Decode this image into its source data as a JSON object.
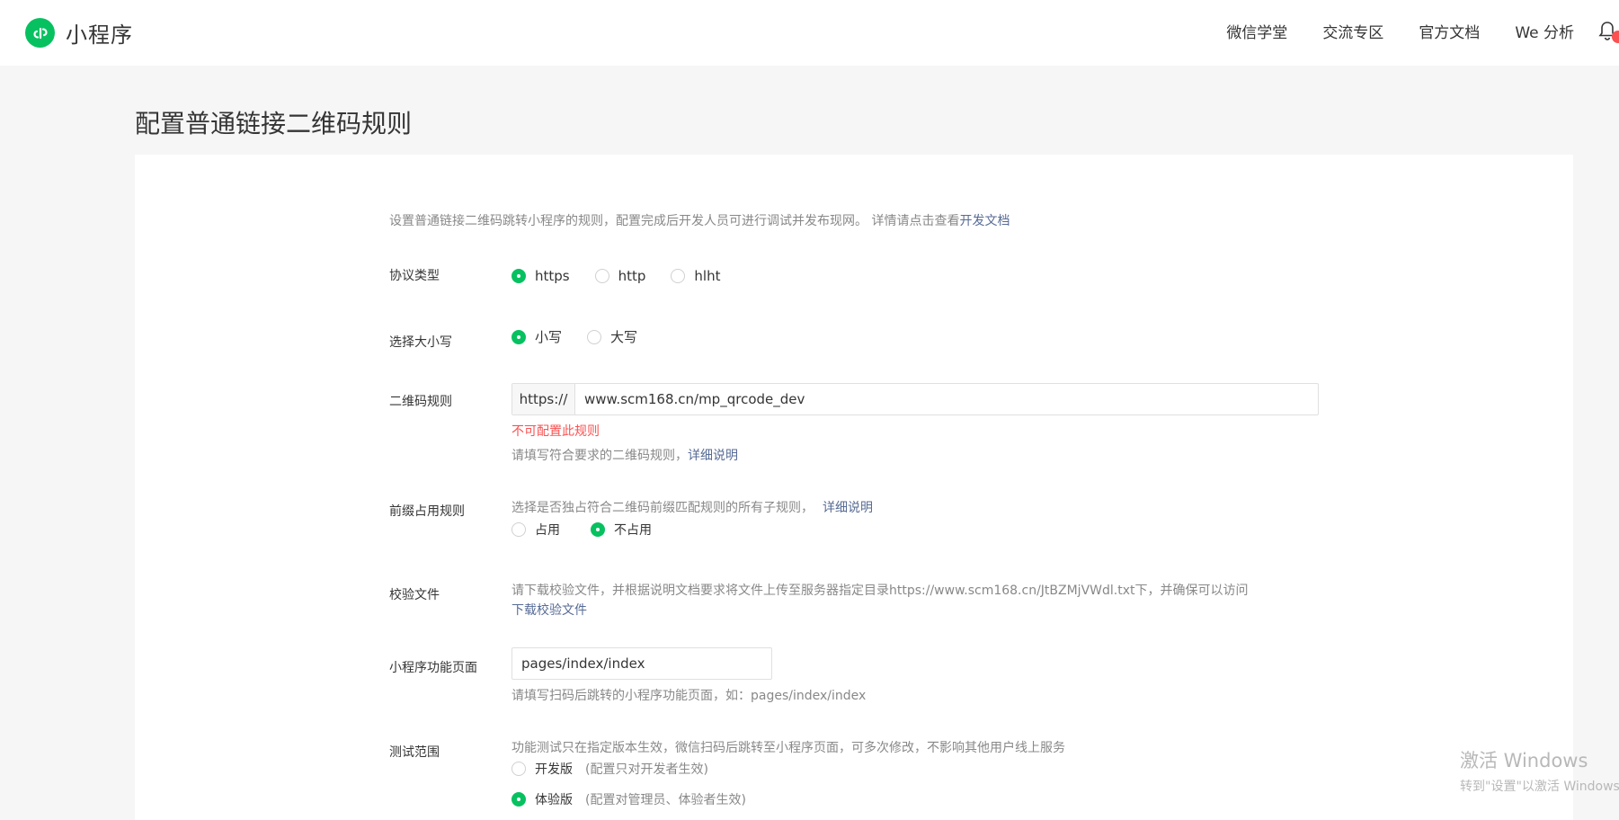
{
  "header": {
    "brand": "小程序",
    "nav": [
      "微信学堂",
      "交流专区",
      "官方文档",
      "We 分析"
    ]
  },
  "page": {
    "title": "配置普通链接二维码规则"
  },
  "intro": {
    "text": "设置普通链接二维码跳转小程序的规则，配置完成后开发人员可进行调试并发布现网。 详情请点击查看",
    "link": "开发文档"
  },
  "protocol": {
    "label": "协议类型",
    "options": [
      "https",
      "http",
      "hlht"
    ],
    "selected": "https"
  },
  "case": {
    "label": "选择大小写",
    "options": [
      "小写",
      "大写"
    ],
    "selected": "小写"
  },
  "qrcode_rule": {
    "label": "二维码规则",
    "prefix": "https://",
    "value": "www.scm168.cn/mp_qrcode_dev",
    "error": "不可配置此规则",
    "hint": "请填写符合要求的二维码规则，",
    "hint_link": "详细说明"
  },
  "prefix_rule": {
    "label": "前缀占用规则",
    "hint": "选择是否独占符合二维码前缀匹配规则的所有子规则，",
    "hint_link": "详细说明",
    "options": [
      "占用",
      "不占用"
    ],
    "selected": "不占用"
  },
  "verify_file": {
    "label": "校验文件",
    "hint": "请下载校验文件，并根据说明文档要求将文件上传至服务器指定目录https://www.scm168.cn/JtBZMjVWdl.txt下，并确保可以访问",
    "download_link": "下载校验文件"
  },
  "page_path": {
    "label": "小程序功能页面",
    "value": "pages/index/index",
    "hint": "请填写扫码后跳转的小程序功能页面，如：pages/index/index"
  },
  "test_scope": {
    "label": "测试范围",
    "hint": "功能测试只在指定版本生效，微信扫码后跳转至小程序页面，可多次修改，不影响其他用户线上服务",
    "options": [
      {
        "label": "开发版",
        "note": "(配置只对开发者生效)"
      },
      {
        "label": "体验版",
        "note": "(配置对管理员、体验者生效)"
      }
    ],
    "selected": "体验版"
  },
  "watermark": {
    "title": "激活 Windows",
    "subtitle": "转到\"设置\"以激活 Windows。"
  },
  "colors": {
    "accent": "#07c160",
    "error": "#fa5151",
    "link": "#576b95"
  }
}
